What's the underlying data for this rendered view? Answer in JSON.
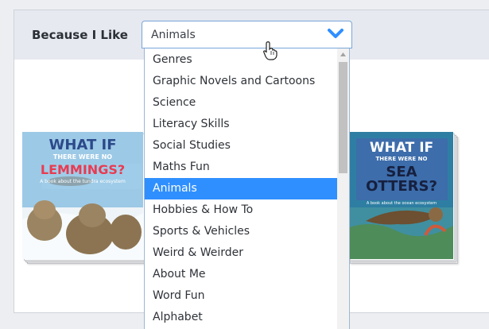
{
  "filter": {
    "label": "Because I Like",
    "selected_value": "Animals",
    "accent_color": "#2f8fff"
  },
  "dropdown": {
    "options": [
      "Genres",
      "Graphic Novels and Cartoons",
      "Science",
      "Literacy Skills",
      "Social Studies",
      "Maths Fun",
      "Animals",
      "Hobbies & How To",
      "Sports & Vehicles",
      "Weird & Weirder",
      "About Me",
      "Word Fun",
      "Alphabet"
    ],
    "selected_index": 6
  },
  "books": [
    {
      "title_line1": "WHAT IF",
      "title_line2": "THERE WERE NO",
      "title_line3": "LEMMINGS?",
      "subtitle": "A book about the tundra ecosystem"
    },
    {
      "title_line1": "WHAT IF",
      "title_line2": "THERE WERE NO",
      "title_line3": "SEA OTTERS?",
      "subtitle": "A book about the ocean ecosystem"
    }
  ]
}
